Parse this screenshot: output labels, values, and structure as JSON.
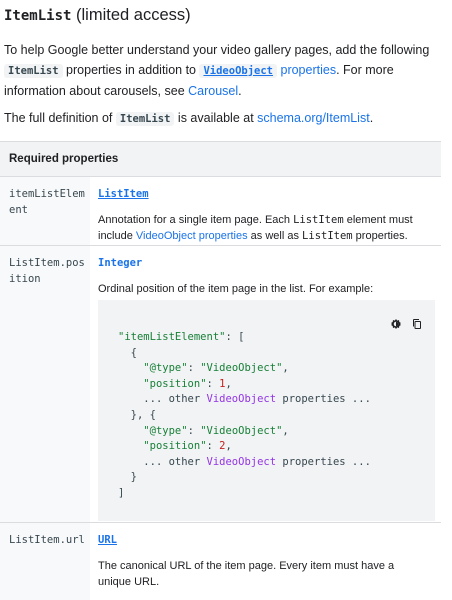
{
  "heading": {
    "code": "ItemList",
    "text": " (limited access)"
  },
  "intro": {
    "p1_a": "To help Google better understand your video gallery pages, add the following ",
    "p1_chip1": "ItemList",
    "p1_b": " properties in addition to ",
    "p1_chip2": "VideoObject",
    "p1_link1": " properties",
    "p1_c": ". For more information about carousels, see ",
    "p1_link2": "Carousel",
    "p1_d": ".",
    "p2_a": "The full definition of ",
    "p2_chip": "ItemList",
    "p2_b": " is available at ",
    "p2_link": "schema.org/ItemList",
    "p2_c": "."
  },
  "table": {
    "header": "Required properties",
    "rows": [
      {
        "name": "itemListElement",
        "type": "ListItem",
        "desc_a": "Annotation for a single item page. Each ",
        "desc_code1": "ListItem",
        "desc_b": " element must include ",
        "desc_link": "VideoObject properties",
        "desc_c": " as well as ",
        "desc_code2": "ListItem",
        "desc_d": " properties."
      },
      {
        "name": "ListItem.position",
        "type": "Integer",
        "desc": "Ordinal position of the item page in the list. For example:"
      },
      {
        "name": "ListItem.url",
        "type": "URL",
        "desc": "The canonical URL of the item page. Every item must have a unique URL."
      }
    ]
  },
  "code": {
    "l1_key": "\"itemListElement\"",
    "l1_rest": ": [",
    "open": "{",
    "type_key": "\"@type\"",
    "colon": ": ",
    "type_val": "\"VideoObject\"",
    "comma": ",",
    "pos_key": "\"position\"",
    "pos1": "1",
    "pos2": "2",
    "other_a": "... other ",
    "other_k": "VideoObject",
    "other_b": " properties ...",
    "mid": "}, {",
    "close": "}",
    "end": "]"
  },
  "icons": [
    "dark-mode-icon",
    "copy-icon"
  ],
  "colors": {
    "link": "#1a73e8",
    "string": "#188038",
    "number": "#c5221f",
    "keyword": "#9334e6"
  }
}
